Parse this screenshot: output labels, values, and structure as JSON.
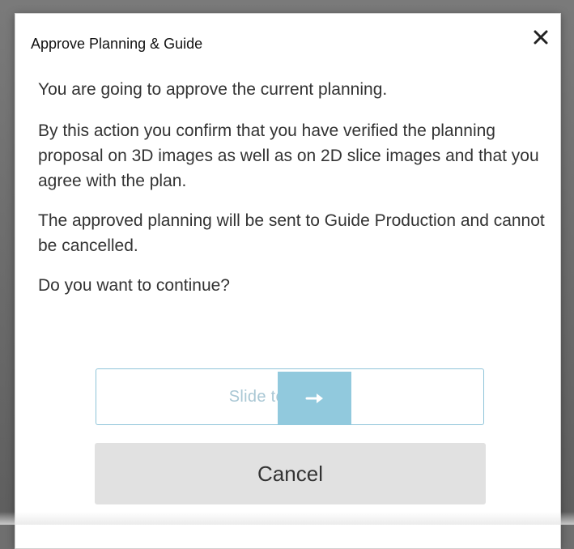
{
  "dialog": {
    "title": "Approve Planning & Guide",
    "close_icon": "close-icon",
    "paragraphs": [
      "You are going to approve the current planning.",
      "By this action you confirm that you have verified the planning proposal on 3D images as well as on 2D slice images and that you agree with the plan.",
      "The approved planning will be sent to Guide Production and cannot be cancelled.",
      "Do you want to continue?"
    ],
    "slider": {
      "label": "Slide to Approve",
      "handle_icon": "arrow-right-icon",
      "progress": 0.0
    },
    "cancel_label": "Cancel"
  },
  "colors": {
    "slider_accent": "#91c9dd",
    "slider_border": "#8fc4d9",
    "cancel_bg": "#e1e1e1",
    "text": "#333333"
  }
}
